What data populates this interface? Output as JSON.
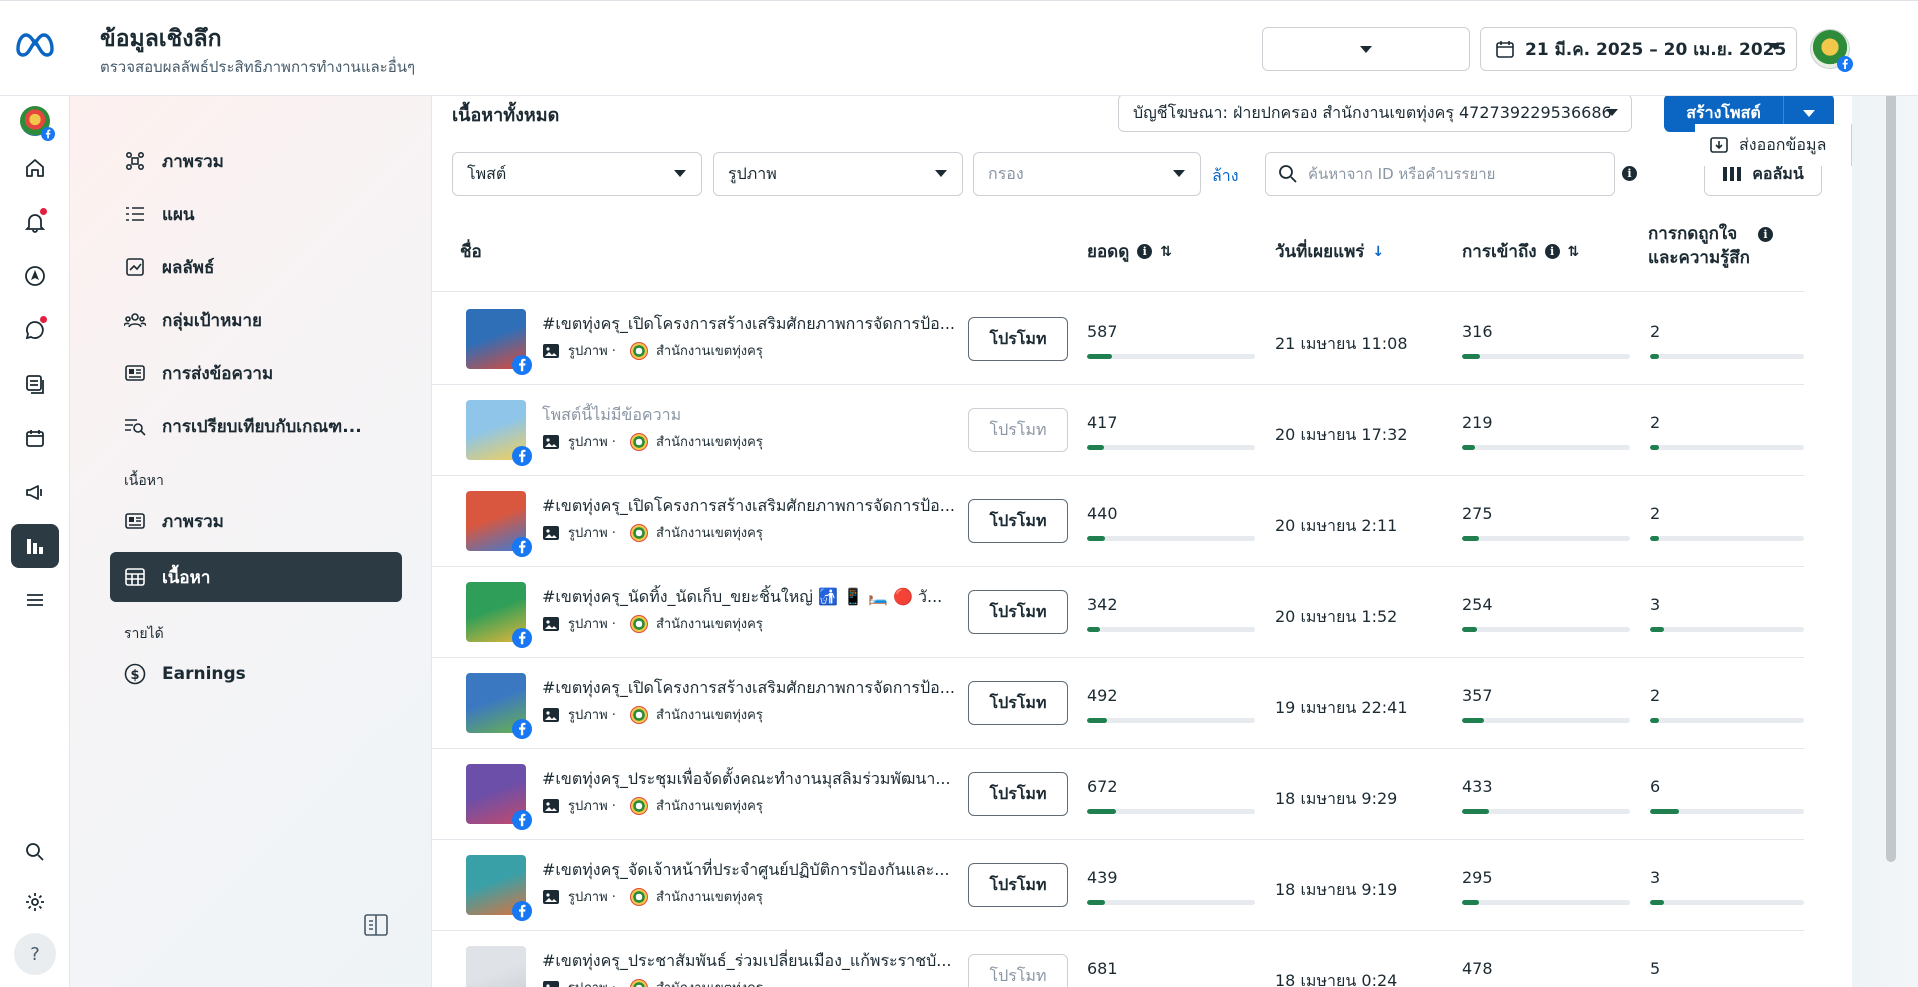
{
  "header": {
    "title": "ข้อมูลเชิงลึก",
    "subtitle": "ตรวจสอบผลลัพธ์ประสิทธิภาพการทำงานและอื่นๆ",
    "export_label": "ส่งออกข้อมูล",
    "date_range": "21 มี.ค. 2025 – 20 เม.ย. 2025"
  },
  "rail": {
    "icons": [
      "home-icon",
      "notifications-icon",
      "navigate-icon",
      "messages-icon",
      "posts-icon",
      "calendar-icon",
      "ads-icon",
      "insights-icon",
      "menu-icon",
      "search-icon",
      "settings-icon",
      "help-icon"
    ],
    "help_label": "?"
  },
  "sidebar": {
    "items": [
      {
        "label": "ภาพรวม",
        "icon": "overview-icon"
      },
      {
        "label": "แผน",
        "icon": "plan-icon"
      },
      {
        "label": "ผลลัพธ์",
        "icon": "results-icon"
      },
      {
        "label": "กลุ่มเป้าหมาย",
        "icon": "audience-icon"
      },
      {
        "label": "การส่งข้อความ",
        "icon": "messaging-icon"
      },
      {
        "label": "การเปรียบเทียบกับเกณฑ...",
        "icon": "benchmark-icon"
      }
    ],
    "content_section": "เนื้อหา",
    "content_items": [
      {
        "label": "ภาพรวม",
        "icon": "content-overview-icon"
      },
      {
        "label": "เนื้อหา",
        "icon": "content-table-icon",
        "active": true
      }
    ],
    "earnings_section": "รายได้",
    "earnings_item": {
      "label": "Earnings",
      "icon": "dollar-icon"
    }
  },
  "main": {
    "section_title": "เนื้อหาทั้งหมด",
    "ad_account": "บัญชีโฆษณา: ฝ่ายปกครอง สำนักงานเขตทุ่งครุ 472739229536686",
    "create_post": "สร้างโพสต์",
    "filters": {
      "post_type": "โพสต์",
      "media_type": "รูปภาพ",
      "filter_placeholder": "กรอง",
      "clear": "ล้าง",
      "search_placeholder": "ค้นหาจาก ID หรือคำบรรยาย",
      "columns": "คอลัมน์"
    },
    "columns": {
      "name": "ชื่อ",
      "views": "ยอดดู",
      "published": "วันที่เผยแพร่",
      "reach": "การเข้าถึง",
      "reactions": "การกดถูกใจและความรู้สึก",
      "reactions_line1": "การกดถูกใจ",
      "reactions_line2": "และความรู้สึก"
    },
    "promote_label": "โปรโมท",
    "media_label": "รูปภาพ ·",
    "page_name": "สำนักงานเขตทุ่งครุ",
    "rows": [
      {
        "title": "#เขตทุ่งครุ_เปิดโครงการสร้างเสริมศักยภาพการจัดการป้อ...",
        "muted": false,
        "views": "587",
        "views_pct": 15,
        "date": "21 เมษายน 11:08",
        "reach": "316",
        "reach_pct": 11,
        "reactions": "2",
        "reactions_pct": 6,
        "promote_disabled": false
      },
      {
        "title": "โพสต์นี้ไม่มีข้อความ",
        "muted": true,
        "views": "417",
        "views_pct": 10,
        "date": "20 เมษายน 17:32",
        "reach": "219",
        "reach_pct": 8,
        "reactions": "2",
        "reactions_pct": 6,
        "promote_disabled": true
      },
      {
        "title": "#เขตทุ่งครุ_เปิดโครงการสร้างเสริมศักยภาพการจัดการป้อ...",
        "muted": false,
        "views": "440",
        "views_pct": 11,
        "date": "20 เมษายน 2:11",
        "reach": "275",
        "reach_pct": 10,
        "reactions": "2",
        "reactions_pct": 6,
        "promote_disabled": false
      },
      {
        "title": "#เขตทุ่งครุ_นัดทิ้ง_นัดเก็บ_ขยะชิ้นใหญ่ 🚮 📱 🛏️ 🔴 วั...",
        "muted": false,
        "views": "342",
        "views_pct": 8,
        "date": "20 เมษายน 1:52",
        "reach": "254",
        "reach_pct": 9,
        "reactions": "3",
        "reactions_pct": 9,
        "promote_disabled": false
      },
      {
        "title": "#เขตทุ่งครุ_เปิดโครงการสร้างเสริมศักยภาพการจัดการป้อ...",
        "muted": false,
        "views": "492",
        "views_pct": 12,
        "date": "19 เมษายน 22:41",
        "reach": "357",
        "reach_pct": 13,
        "reactions": "2",
        "reactions_pct": 6,
        "promote_disabled": false
      },
      {
        "title": "#เขตทุ่งครุ_ประชุมเพื่อจัดตั้งคณะทำงานมุสลิมร่วมพัฒนา...",
        "muted": false,
        "views": "672",
        "views_pct": 17,
        "date": "18 เมษายน 9:29",
        "reach": "433",
        "reach_pct": 16,
        "reactions": "6",
        "reactions_pct": 19,
        "promote_disabled": false
      },
      {
        "title": "#เขตทุ่งครุ_จัดเจ้าหน้าที่ประจำศูนย์ปฏิบัติการป้องกันและ...",
        "muted": false,
        "views": "439",
        "views_pct": 11,
        "date": "18 เมษายน 9:19",
        "reach": "295",
        "reach_pct": 10,
        "reactions": "3",
        "reactions_pct": 9,
        "promote_disabled": false
      },
      {
        "title": "#เขตทุ่งครุ_ประชาสัมพันธ์_ร่วมเปลี่ยนเมือง_แก้พระราชบั...",
        "muted": false,
        "views": "681",
        "views_pct": 18,
        "date": "18 เมษายน 0:24",
        "reach": "478",
        "reach_pct": 17,
        "reactions": "5",
        "reactions_pct": 15,
        "promote_disabled": true
      }
    ]
  },
  "colors": {
    "accent": "#0a66c2",
    "bar": "#1f7f4f",
    "active_nav": "#2c3a44"
  }
}
